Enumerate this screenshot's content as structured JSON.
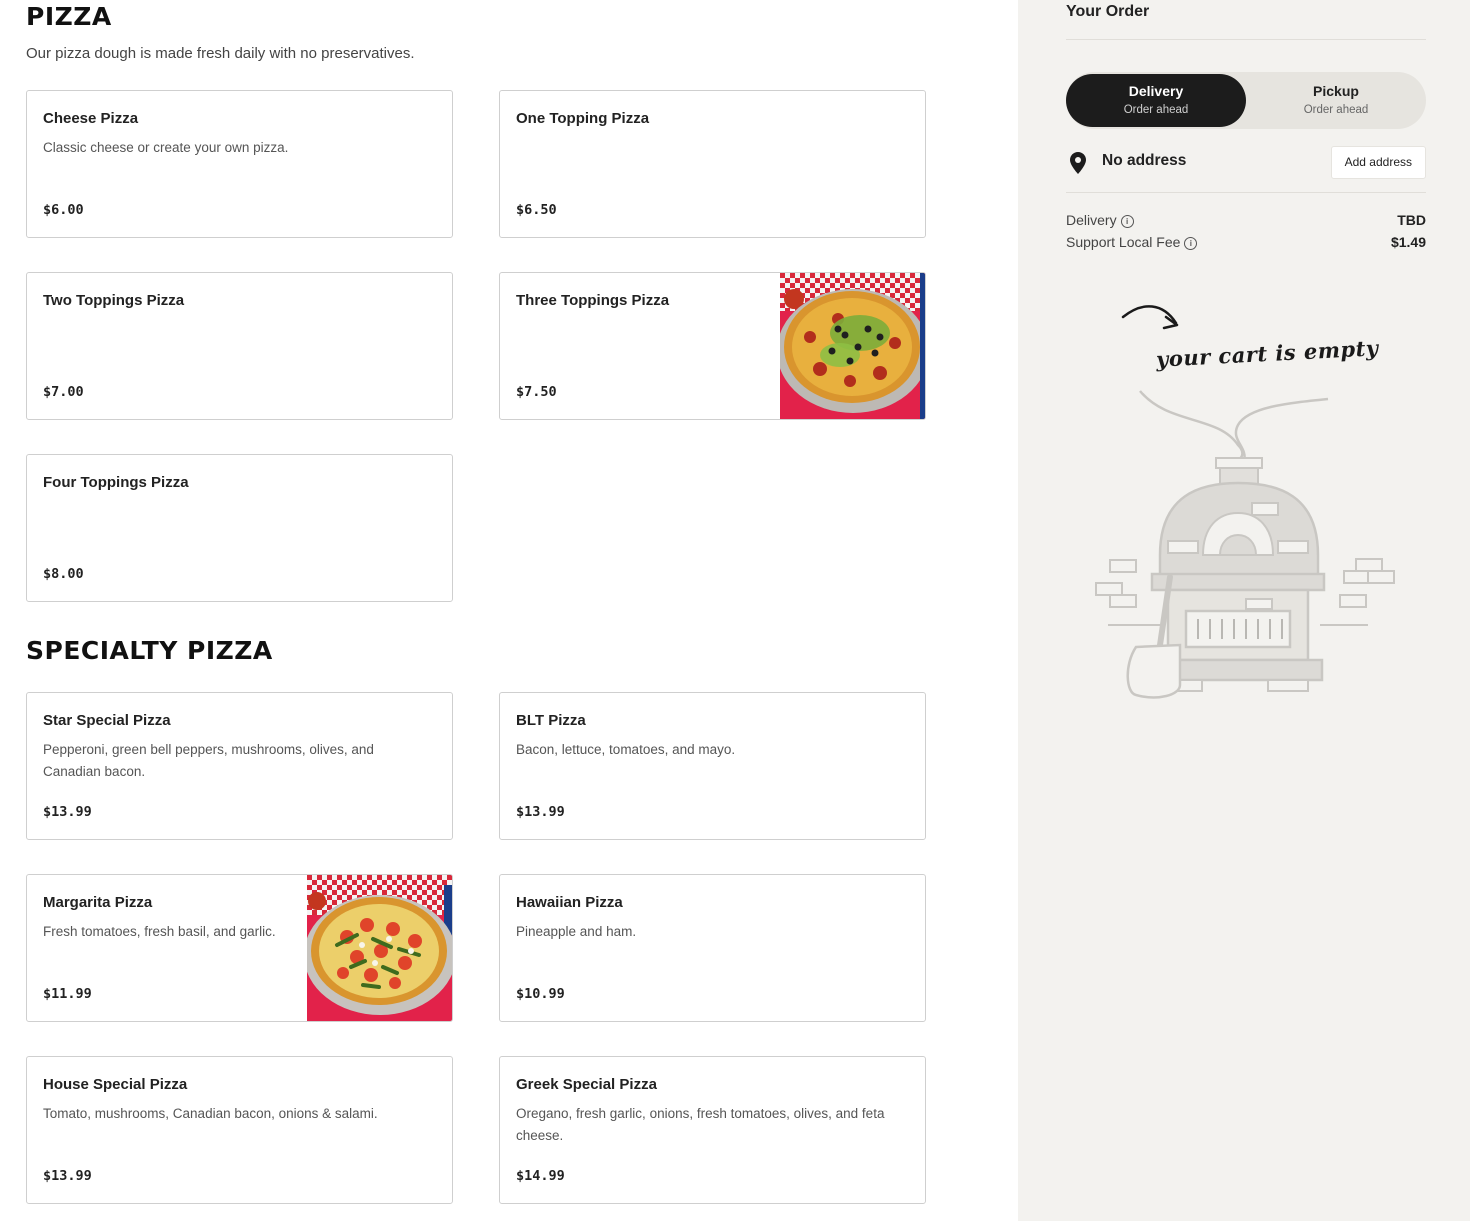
{
  "sections": [
    {
      "title": "PIZZA",
      "description": "Our pizza dough is made fresh daily with no preservatives.",
      "items": [
        {
          "name": "Cheese Pizza",
          "description": "Classic cheese or create your own pizza.",
          "price": "$6.00"
        },
        {
          "name": "One Topping Pizza",
          "description": "",
          "price": "$6.50"
        },
        {
          "name": "Two Toppings Pizza",
          "description": "",
          "price": "$7.00"
        },
        {
          "name": "Three Toppings Pizza",
          "description": "",
          "price": "$7.50"
        },
        {
          "name": "Four Toppings Pizza",
          "description": "",
          "price": "$8.00"
        }
      ]
    },
    {
      "title": "SPECIALTY PIZZA",
      "items": [
        {
          "name": "Star Special Pizza",
          "description": "Pepperoni, green bell peppers, mushrooms, olives, and Canadian bacon.",
          "price": "$13.99"
        },
        {
          "name": "BLT Pizza",
          "description": "Bacon, lettuce, tomatoes, and mayo.",
          "price": "$13.99"
        },
        {
          "name": "Margarita Pizza",
          "description": "Fresh tomatoes, fresh basil, and garlic.",
          "price": "$11.99"
        },
        {
          "name": "Hawaiian Pizza",
          "description": "Pineapple and ham.",
          "price": "$10.99"
        },
        {
          "name": "House Special Pizza",
          "description": "Tomato, mushrooms, Canadian bacon, onions & salami.",
          "price": "$13.99"
        },
        {
          "name": "Greek Special Pizza",
          "description": "Oregano, fresh garlic, onions, fresh tomatoes, olives, and feta cheese.",
          "price": "$14.99"
        }
      ]
    }
  ],
  "order": {
    "title": "Your Order",
    "modes": [
      {
        "label": "Delivery",
        "sub": "Order ahead",
        "active": true
      },
      {
        "label": "Pickup",
        "sub": "Order ahead",
        "active": false
      }
    ],
    "address": {
      "text": "No address",
      "button": "Add address",
      "icon": "location-pin-icon"
    },
    "fees": [
      {
        "label": "Delivery",
        "value": "TBD",
        "icon": "info-icon"
      },
      {
        "label": "Support Local Fee",
        "value": "$1.49",
        "icon": "info-icon"
      }
    ],
    "empty_cart_text": "your cart is empty"
  },
  "colors": {
    "dark": "#1c1c1c",
    "sidebar_bg": "#f3f2ef",
    "toggle_bg": "#e6e4df",
    "border": "#cfcfcf"
  }
}
